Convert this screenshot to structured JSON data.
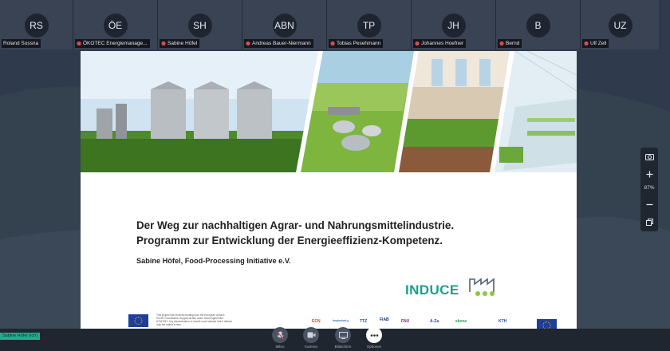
{
  "participants": [
    {
      "initials": "RS",
      "name": "Roland Sossna"
    },
    {
      "initials": "ÖE",
      "name": "ÖKOTEC Energiemanage..."
    },
    {
      "initials": "SH",
      "name": "Sabine Höfel"
    },
    {
      "initials": "ABN",
      "name": "Andreas Bauer-Niermann"
    },
    {
      "initials": "TP",
      "name": "Tobias Pesehmann"
    },
    {
      "initials": "JH",
      "name": "Johannes Hoefner"
    },
    {
      "initials": "B",
      "name": "Bernd"
    },
    {
      "initials": "UZ",
      "name": "Ulf Zell"
    }
  ],
  "slide": {
    "title_line1": "Der Weg zur nachhaltigen Agrar- und Nahrungsmittelindustrie.",
    "title_line2": "Programm zur Entwicklung der Energieeffizienz-Kompetenz.",
    "author": "Sabine Höfel, Food-Processing Initiative e.V.",
    "brand": "INDUCE",
    "footer_text": "This project has received funding from the European Union's H2020 Coordination Support Action under Grant Agreement N°847547. Any dissemination of results must indicate that it reflects only the author's view.",
    "partner_logos": [
      "ECN",
      "lesdoctorLy",
      "TTZ",
      "FIAB",
      "FNU",
      "A-Za",
      "ekonz",
      "KTH"
    ]
  },
  "toolbar": {
    "zoom": "87%"
  },
  "self_view": {
    "name": "Sabine Höfel (Ich)"
  },
  "controls": [
    {
      "label": "Mikro",
      "icon": "microphone-icon"
    },
    {
      "label": "Kamera",
      "icon": "camera-icon"
    },
    {
      "label": "Bildschirm",
      "icon": "screen-share-icon"
    },
    {
      "label": "Optionen",
      "icon": "more-icon"
    }
  ],
  "colors": {
    "accent": "#1f9e8c",
    "background": "#2f3b4c",
    "self_badge": "#1fae8f"
  }
}
